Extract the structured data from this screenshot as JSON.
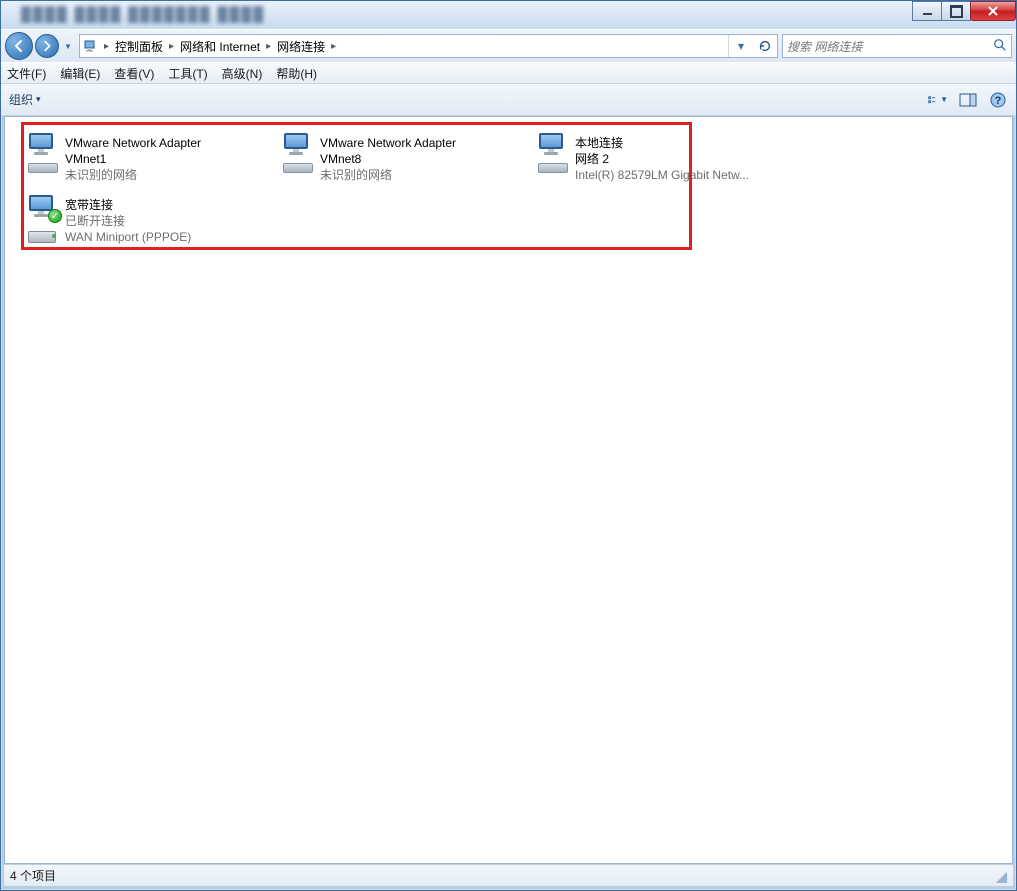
{
  "window": {
    "blurred_title": "████ ████ ███████ ████"
  },
  "breadcrumbs": {
    "root_sep": "▸",
    "items": [
      {
        "label": "控制面板"
      },
      {
        "label": "网络和 Internet"
      },
      {
        "label": "网络连接"
      }
    ]
  },
  "search": {
    "placeholder": "搜索 网络连接"
  },
  "menu": {
    "file": "文件(F)",
    "edit": "编辑(E)",
    "view": "查看(V)",
    "tools": "工具(T)",
    "adv": "高级(N)",
    "help": "帮助(H)"
  },
  "toolbar": {
    "organize": "组织",
    "organize_caret": "▾"
  },
  "connections": [
    {
      "name_top": "VMware Network Adapter",
      "name_line1": "VMnet1",
      "name_line2": "未识别的网络",
      "icon": "nic"
    },
    {
      "name_top": "VMware Network Adapter",
      "name_line1": "VMnet8",
      "name_line2": "未识别的网络",
      "icon": "nic"
    },
    {
      "name_top": "本地连接",
      "name_line1": "网络  2",
      "name_line2": "Intel(R) 82579LM Gigabit Netw...",
      "icon": "nic"
    },
    {
      "name_top": "宽带连接",
      "name_line1": "已断开连接",
      "name_line2": "WAN Miniport (PPPOE)",
      "icon": "modem",
      "badge": "check"
    }
  ],
  "status": {
    "text": "4 个项目"
  }
}
